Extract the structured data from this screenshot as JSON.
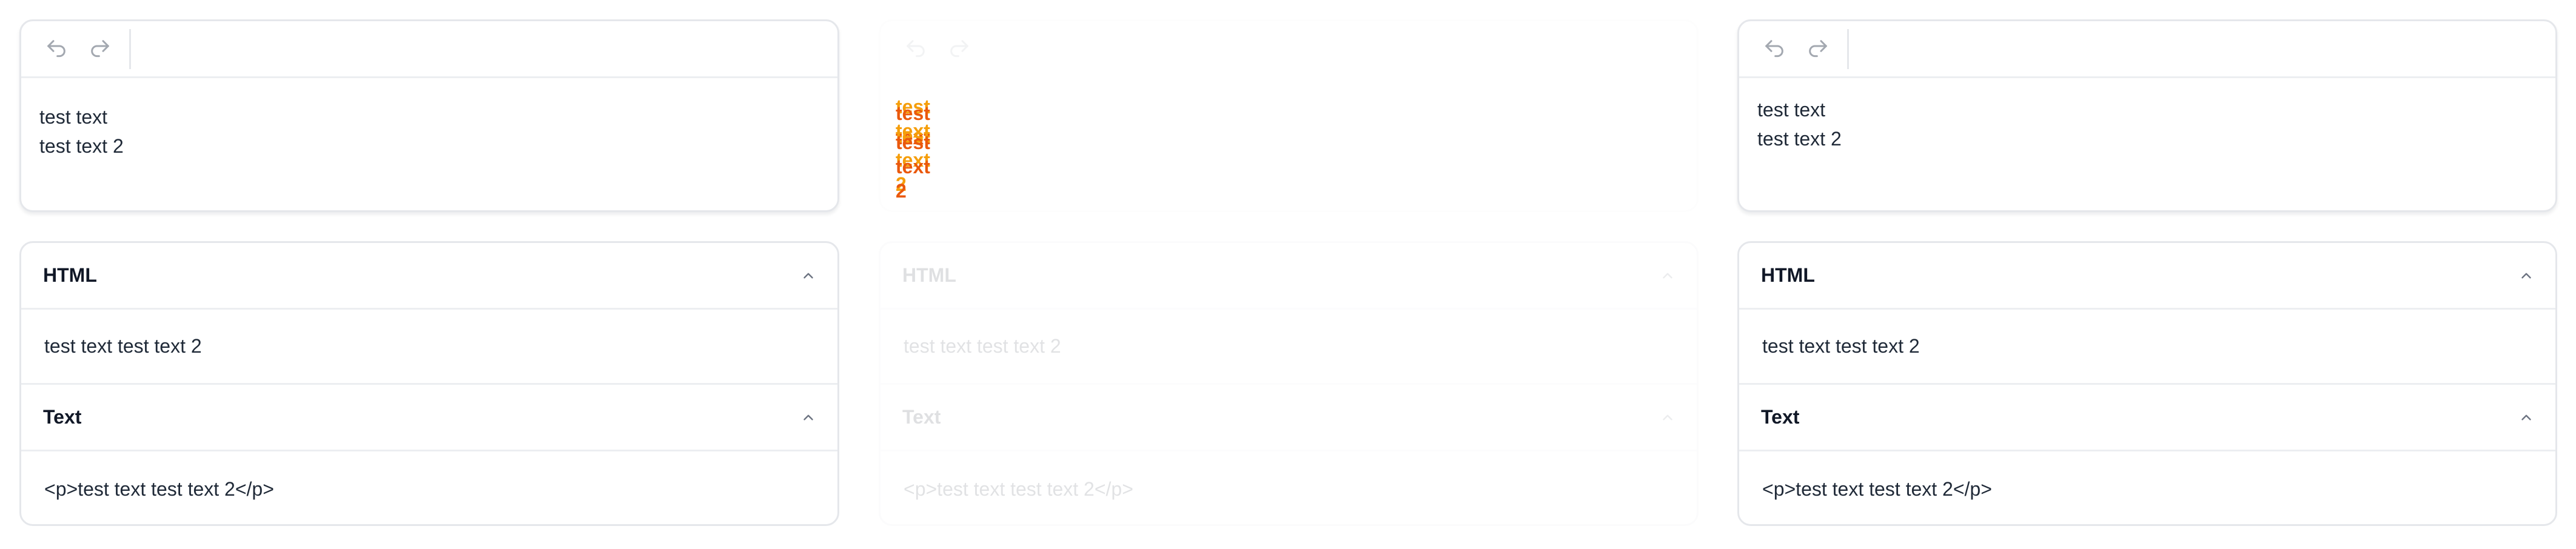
{
  "icons": {
    "undo": "undo-icon",
    "redo": "redo-icon",
    "chevron": "chevron-up-icon"
  },
  "colors": {
    "border": "#e5e7eb",
    "icon": "#9ca3af",
    "highlight_orange": "#f59e0b"
  },
  "editors": [
    {
      "lines": [
        "test text",
        "test text 2"
      ]
    },
    {
      "lines": [
        "test text",
        "test text 2"
      ]
    },
    {
      "lines": [
        "test text",
        "test text 2"
      ]
    }
  ],
  "panels": [
    {
      "html_title": "HTML",
      "html_value": "test text test text 2",
      "text_title": "Text",
      "text_value": "<p>test text test text 2</p>"
    },
    {
      "html_title": "HTML",
      "html_value": "test text test text 2",
      "text_title": "Text",
      "text_value": "<p>test text test text 2</p>"
    },
    {
      "html_title": "HTML",
      "html_value": "test text test text 2",
      "text_title": "Text",
      "text_value": "<p>test text test text 2</p>"
    }
  ]
}
